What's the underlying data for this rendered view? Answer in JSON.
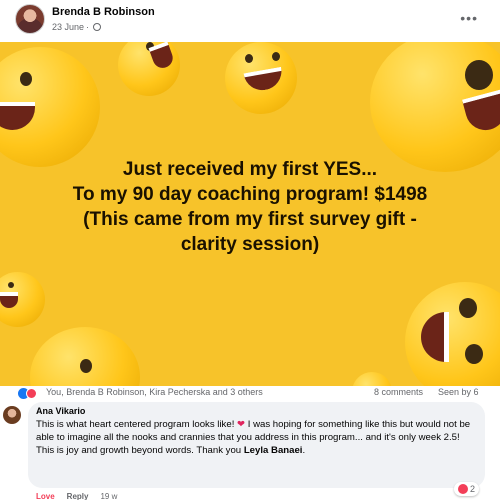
{
  "post": {
    "author": "Brenda B Robinson",
    "date": "23 June",
    "more_icon": "more-icon",
    "image_text_lines": [
      "Just received my first YES...",
      "To my 90 day coaching program! $1498",
      "(This came from my first survey gift -",
      "clarity session)"
    ]
  },
  "reactions": {
    "names": "You, Brenda B Robinson, Kira Pecherska and 3 others",
    "comments": "8 comments",
    "seen": "Seen by 6",
    "icons": [
      "like-icon",
      "love-icon"
    ]
  },
  "comment": {
    "author": "Ana Vikario",
    "text_before_heart": "This is what heart centered program looks like! ",
    "heart": "❤",
    "text_after_heart": " I was hoping for something like this but would not be able to imagine all the nooks and crannies that you address in this program... and it's only week 2.5! This is joy and growth beyond words. Thank you ",
    "mention": "Leyla Banaei",
    "text_end": ".",
    "reaction_count": "2",
    "actions": {
      "love": "Love",
      "reply": "Reply",
      "time": "19 w"
    }
  }
}
